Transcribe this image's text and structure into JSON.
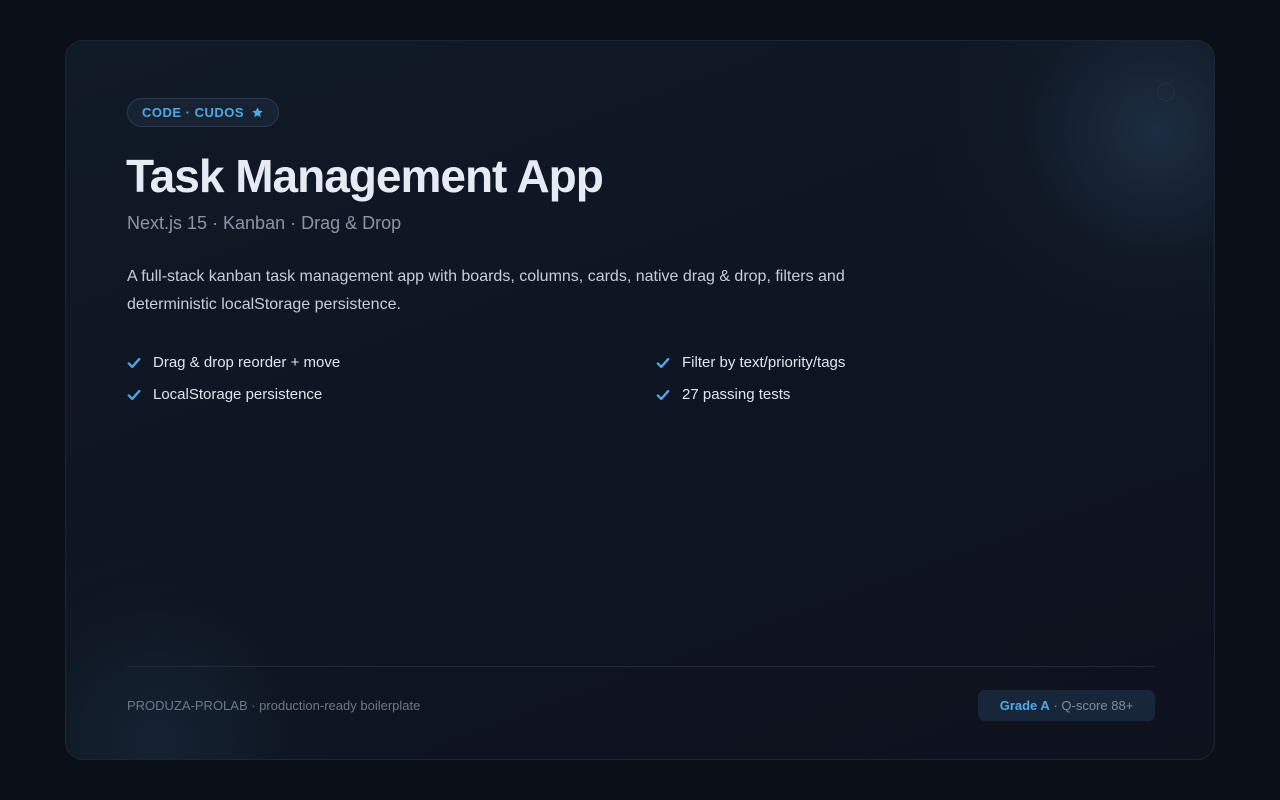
{
  "badge": {
    "label": "CODE · CUDOS",
    "icon": "star-icon",
    "color": "#4fa9e6"
  },
  "project": {
    "title": "Task Management App",
    "subtitle": "Next.js 15 · Kanban · Drag & Drop",
    "description": "A full-stack kanban task management app with boards, columns, cards, native drag & drop, filters and deterministic localStorage persistence."
  },
  "features": [
    {
      "label": "Drag & drop reorder + move",
      "icon": "check-icon"
    },
    {
      "label": "Filter by text/priority/tags",
      "icon": "check-icon"
    },
    {
      "label": "LocalStorage persistence",
      "icon": "check-icon"
    },
    {
      "label": "27 passing tests",
      "icon": "check-icon"
    }
  ],
  "footer": {
    "brand": "PRODUZA-PROLAB · production-ready boilerplate",
    "grade": "Grade A",
    "separator": " · ",
    "score": "Q-score 88+"
  },
  "colors": {
    "accent": "#4fa9e6",
    "background": "#0b0f17",
    "card": "#0f1522"
  }
}
